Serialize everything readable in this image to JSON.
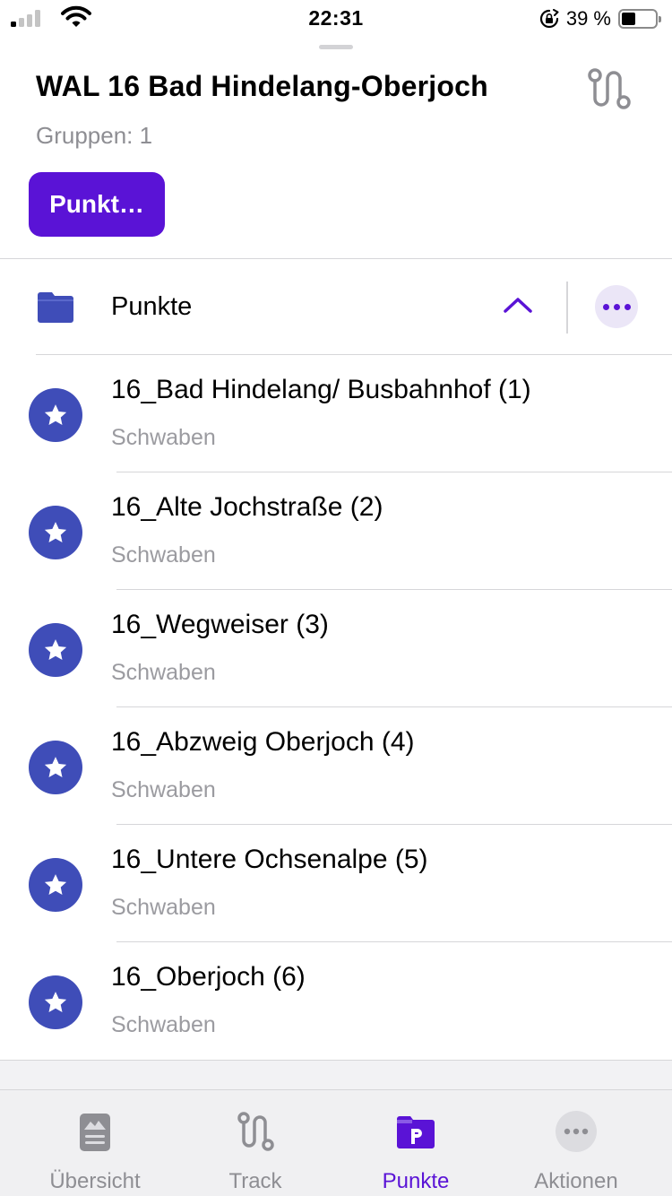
{
  "status_bar": {
    "time": "22:31",
    "battery_percent": "39 %",
    "battery_level": 0.39,
    "signal_bars_active": 1,
    "signal_bars_total": 4
  },
  "header": {
    "title": "WAL 16 Bad Hindelang-Oberjoch",
    "groups": "Gruppen: 1",
    "punkt_button": "Punkt…",
    "track_icon": "route-icon"
  },
  "folder": {
    "label": "Punkte",
    "expanded": true,
    "icon": "folder-icon"
  },
  "points": [
    {
      "name": "16_Bad Hindelang/ Busbahnhof (1)",
      "region": "Schwaben"
    },
    {
      "name": "16_Alte Jochstraße (2)",
      "region": "Schwaben"
    },
    {
      "name": "16_Wegweiser (3)",
      "region": "Schwaben"
    },
    {
      "name": "16_Abzweig Oberjoch (4)",
      "region": "Schwaben"
    },
    {
      "name": "16_Untere Ochsenalpe (5)",
      "region": "Schwaben"
    },
    {
      "name": "16_Oberjoch (6)",
      "region": "Schwaben"
    }
  ],
  "tabs": [
    {
      "label": "Übersicht",
      "icon": "overview-icon",
      "active": false
    },
    {
      "label": "Track",
      "icon": "route-icon",
      "active": false
    },
    {
      "label": "Punkte",
      "icon": "points-folder-icon",
      "active": true
    },
    {
      "label": "Aktionen",
      "icon": "more-icon",
      "active": false
    }
  ],
  "colors": {
    "accent": "#5a13d6",
    "point_marker": "#3f4db8",
    "secondary_text": "#8e8e93"
  }
}
